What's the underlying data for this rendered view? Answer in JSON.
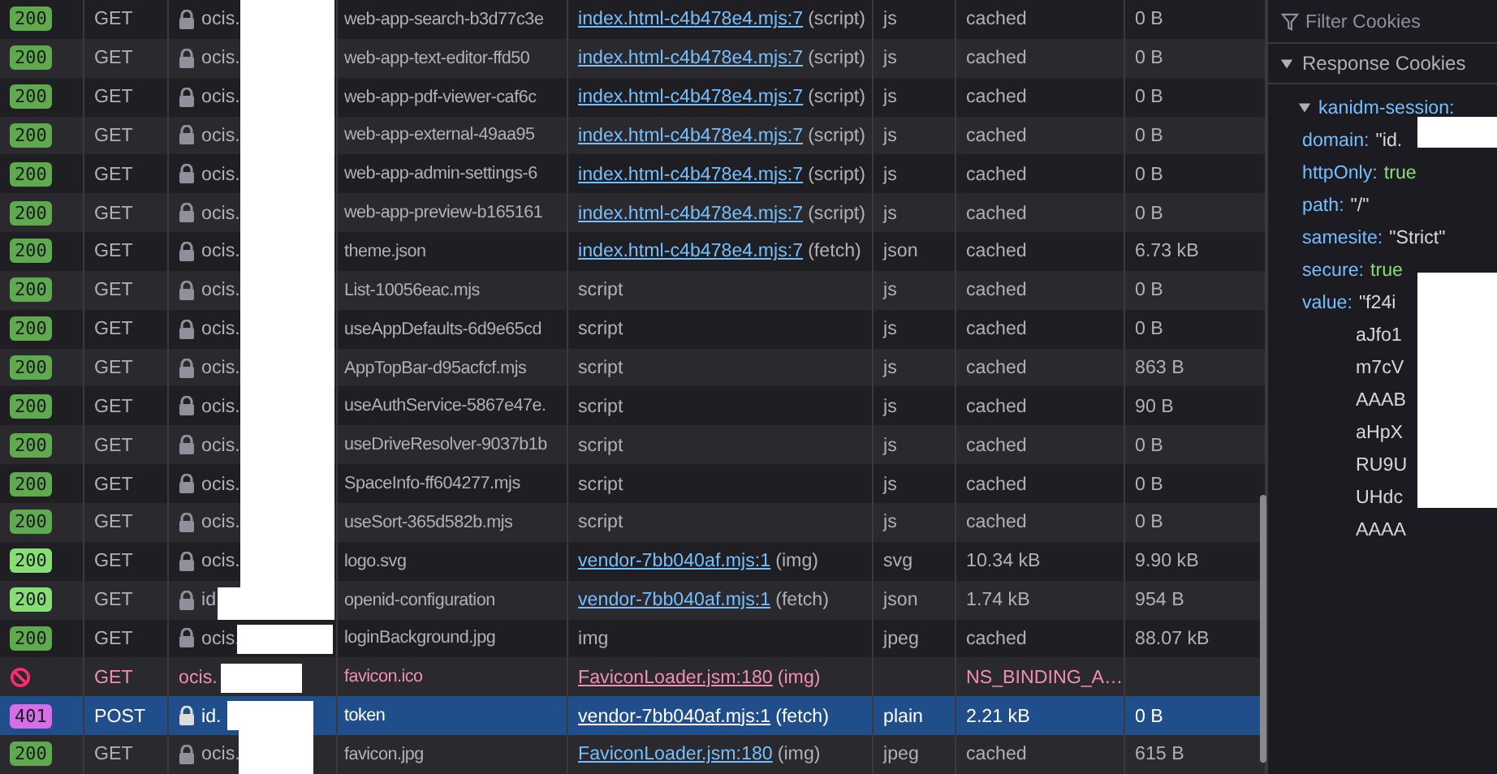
{
  "requests": [
    {
      "status": "200",
      "color": "#5fa94f",
      "method": "GET",
      "domain": "ocis.",
      "secure": true,
      "file": "web-app-search-b3d77c3e",
      "initiator_link": "index.html-c4b478e4.mjs:7",
      "initiator_note": "(script)",
      "type": "js",
      "transferred": "cached",
      "size": "0 B",
      "blocked": false,
      "selected": false
    },
    {
      "status": "200",
      "color": "#5fa94f",
      "method": "GET",
      "domain": "ocis.",
      "secure": true,
      "file": "web-app-text-editor-ffd50",
      "initiator_link": "index.html-c4b478e4.mjs:7",
      "initiator_note": "(script)",
      "type": "js",
      "transferred": "cached",
      "size": "0 B",
      "blocked": false,
      "selected": false
    },
    {
      "status": "200",
      "color": "#5fa94f",
      "method": "GET",
      "domain": "ocis.",
      "secure": true,
      "file": "web-app-pdf-viewer-caf6c",
      "initiator_link": "index.html-c4b478e4.mjs:7",
      "initiator_note": "(script)",
      "type": "js",
      "transferred": "cached",
      "size": "0 B",
      "blocked": false,
      "selected": false
    },
    {
      "status": "200",
      "color": "#5fa94f",
      "method": "GET",
      "domain": "ocis.",
      "secure": true,
      "file": "web-app-external-49aa95",
      "initiator_link": "index.html-c4b478e4.mjs:7",
      "initiator_note": "(script)",
      "type": "js",
      "transferred": "cached",
      "size": "0 B",
      "blocked": false,
      "selected": false
    },
    {
      "status": "200",
      "color": "#5fa94f",
      "method": "GET",
      "domain": "ocis.",
      "secure": true,
      "file": "web-app-admin-settings-6",
      "initiator_link": "index.html-c4b478e4.mjs:7",
      "initiator_note": "(script)",
      "type": "js",
      "transferred": "cached",
      "size": "0 B",
      "blocked": false,
      "selected": false
    },
    {
      "status": "200",
      "color": "#5fa94f",
      "method": "GET",
      "domain": "ocis.",
      "secure": true,
      "file": "web-app-preview-b165161",
      "initiator_link": "index.html-c4b478e4.mjs:7",
      "initiator_note": "(script)",
      "type": "js",
      "transferred": "cached",
      "size": "0 B",
      "blocked": false,
      "selected": false
    },
    {
      "status": "200",
      "color": "#5fa94f",
      "method": "GET",
      "domain": "ocis.",
      "secure": true,
      "file": "theme.json",
      "initiator_link": "index.html-c4b478e4.mjs:7",
      "initiator_note": "(fetch)",
      "type": "json",
      "transferred": "cached",
      "size": "6.73 kB",
      "blocked": false,
      "selected": false
    },
    {
      "status": "200",
      "color": "#5fa94f",
      "method": "GET",
      "domain": "ocis.",
      "secure": true,
      "file": "List-10056eac.mjs",
      "initiator_note": "script",
      "type": "js",
      "transferred": "cached",
      "size": "0 B",
      "blocked": false,
      "selected": false
    },
    {
      "status": "200",
      "color": "#5fa94f",
      "method": "GET",
      "domain": "ocis.",
      "secure": true,
      "file": "useAppDefaults-6d9e65cd",
      "initiator_note": "script",
      "type": "js",
      "transferred": "cached",
      "size": "0 B",
      "blocked": false,
      "selected": false
    },
    {
      "status": "200",
      "color": "#5fa94f",
      "method": "GET",
      "domain": "ocis.",
      "secure": true,
      "file": "AppTopBar-d95acfcf.mjs",
      "initiator_note": "script",
      "type": "js",
      "transferred": "cached",
      "size": "863 B",
      "blocked": false,
      "selected": false
    },
    {
      "status": "200",
      "color": "#5fa94f",
      "method": "GET",
      "domain": "ocis.",
      "secure": true,
      "file": "useAuthService-5867e47e.",
      "initiator_note": "script",
      "type": "js",
      "transferred": "cached",
      "size": "90 B",
      "blocked": false,
      "selected": false
    },
    {
      "status": "200",
      "color": "#5fa94f",
      "method": "GET",
      "domain": "ocis.",
      "secure": true,
      "file": "useDriveResolver-9037b1b",
      "initiator_note": "script",
      "type": "js",
      "transferred": "cached",
      "size": "0 B",
      "blocked": false,
      "selected": false
    },
    {
      "status": "200",
      "color": "#5fa94f",
      "method": "GET",
      "domain": "ocis.",
      "secure": true,
      "file": "SpaceInfo-ff604277.mjs",
      "initiator_note": "script",
      "type": "js",
      "transferred": "cached",
      "size": "0 B",
      "blocked": false,
      "selected": false
    },
    {
      "status": "200",
      "color": "#5fa94f",
      "method": "GET",
      "domain": "ocis.",
      "secure": true,
      "file": "useSort-365d582b.mjs",
      "initiator_note": "script",
      "type": "js",
      "transferred": "cached",
      "size": "0 B",
      "blocked": false,
      "selected": false
    },
    {
      "status": "200",
      "color": "#86de74",
      "method": "GET",
      "domain": "ocis.",
      "secure": true,
      "file": "logo.svg",
      "initiator_link": "vendor-7bb040af.mjs:1",
      "initiator_note": "(img)",
      "type": "svg",
      "transferred": "10.34 kB",
      "size": "9.90 kB",
      "blocked": false,
      "selected": false
    },
    {
      "status": "200",
      "color": "#86de74",
      "method": "GET",
      "domain": "id",
      "secure": true,
      "file": "openid-configuration",
      "initiator_link": "vendor-7bb040af.mjs:1",
      "initiator_note": "(fetch)",
      "type": "json",
      "transferred": "1.74 kB",
      "size": "954 B",
      "blocked": false,
      "selected": false
    },
    {
      "status": "200",
      "color": "#5fa94f",
      "method": "GET",
      "domain": "ocis.",
      "secure": true,
      "file": "loginBackground.jpg",
      "initiator_note": "img",
      "type": "jpeg",
      "transferred": "cached",
      "size": "88.07 kB",
      "blocked": false,
      "selected": false
    },
    {
      "method": "GET",
      "domain": "ocis.",
      "secure": false,
      "file": "favicon.ico",
      "initiator_link": "FaviconLoader.jsm:180",
      "initiator_note": "(img)",
      "transferred": "NS_BINDING_A…",
      "blocked": true,
      "selected": false
    },
    {
      "status": "401",
      "color": "#d56ee8",
      "method": "POST",
      "domain": "id.",
      "secure": true,
      "file": "token",
      "initiator_link": "vendor-7bb040af.mjs:1",
      "initiator_note": "(fetch)",
      "type": "plain",
      "transferred": "2.21 kB",
      "size": "0 B",
      "blocked": false,
      "selected": true
    },
    {
      "status": "200",
      "color": "#5fa94f",
      "method": "GET",
      "domain": "ocis.",
      "secure": true,
      "file": "favicon.jpg",
      "initiator_link": "FaviconLoader.jsm:180",
      "initiator_note": "(img)",
      "type": "jpeg",
      "transferred": "cached",
      "size": "615 B",
      "blocked": false,
      "selected": false
    }
  ],
  "cookies": {
    "filter": {
      "placeholder": "Filter Cookies"
    },
    "section": {
      "label": "Response Cookies",
      "expanded": true
    },
    "cookie": {
      "name": "kanidm-session:",
      "expanded": true,
      "props": [
        {
          "key": "domain:",
          "value": "\"id.",
          "kind": "string"
        },
        {
          "key": "httpOnly:",
          "value": "true",
          "kind": "bool"
        },
        {
          "key": "path:",
          "value": "\"/\"",
          "kind": "string"
        },
        {
          "key": "samesite:",
          "value": "\"Strict\"",
          "kind": "string"
        },
        {
          "key": "secure:",
          "value": "true",
          "kind": "bool"
        },
        {
          "key": "value:",
          "value": "\"f24i",
          "kind": "string",
          "more": [
            "aJfo1",
            "m7cV",
            "AAAB",
            "aHpX",
            "RU9U",
            "UHdc",
            "AAAA"
          ]
        }
      ]
    }
  }
}
